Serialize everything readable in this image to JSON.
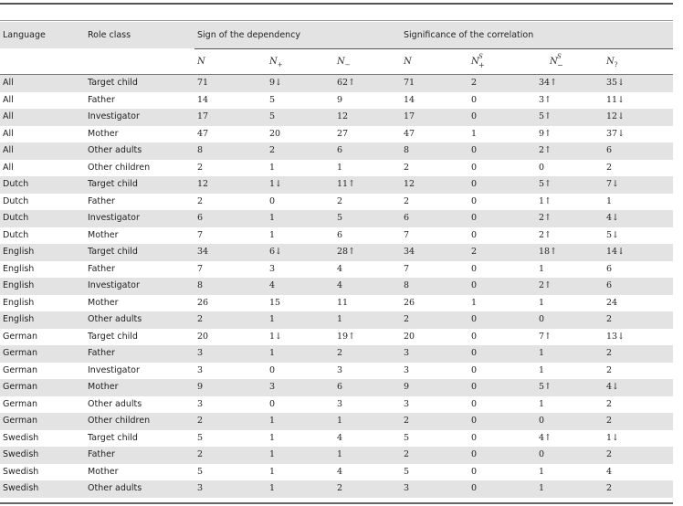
{
  "table": {
    "group_headers": {
      "language": "Language",
      "role_class": "Role class",
      "sign": "Sign of the dependency",
      "significance": "Significance of the correlation"
    },
    "sub_headers": {
      "sign_n": "N",
      "sign_n_plus": "N",
      "sign_n_plus_sub": "+",
      "sign_n_minus": "N",
      "sign_n_minus_sub": "−",
      "sig_n": "N",
      "sig_ns_plus": "N",
      "sig_ns_plus_sup": "S",
      "sig_ns_plus_sub": "+",
      "sig_ns_minus": "N",
      "sig_ns_minus_sup": "S",
      "sig_ns_minus_sub": "−",
      "sig_n_q": "N",
      "sig_n_q_sub": "?"
    },
    "rows": [
      [
        "All",
        "Target child",
        "71",
        "9↓",
        "62↑",
        "71",
        "2",
        "34↑",
        "35↓"
      ],
      [
        "All",
        "Father",
        "14",
        "5",
        "9",
        "14",
        "0",
        "3↑",
        "11↓"
      ],
      [
        "All",
        "Investigator",
        "17",
        "5",
        "12",
        "17",
        "0",
        "5↑",
        "12↓"
      ],
      [
        "All",
        "Mother",
        "47",
        "20",
        "27",
        "47",
        "1",
        "9↑",
        "37↓"
      ],
      [
        "All",
        "Other adults",
        "8",
        "2",
        "6",
        "8",
        "0",
        "2↑",
        "6"
      ],
      [
        "All",
        "Other children",
        "2",
        "1",
        "1",
        "2",
        "0",
        "0",
        "2"
      ],
      [
        "Dutch",
        "Target child",
        "12",
        "1↓",
        "11↑",
        "12",
        "0",
        "5↑",
        "7↓"
      ],
      [
        "Dutch",
        "Father",
        "2",
        "0",
        "2",
        "2",
        "0",
        "1↑",
        "1"
      ],
      [
        "Dutch",
        "Investigator",
        "6",
        "1",
        "5",
        "6",
        "0",
        "2↑",
        "4↓"
      ],
      [
        "Dutch",
        "Mother",
        "7",
        "1",
        "6",
        "7",
        "0",
        "2↑",
        "5↓"
      ],
      [
        "English",
        "Target child",
        "34",
        "6↓",
        "28↑",
        "34",
        "2",
        "18↑",
        "14↓"
      ],
      [
        "English",
        "Father",
        "7",
        "3",
        "4",
        "7",
        "0",
        "1",
        "6"
      ],
      [
        "English",
        "Investigator",
        "8",
        "4",
        "4",
        "8",
        "0",
        "2↑",
        "6"
      ],
      [
        "English",
        "Mother",
        "26",
        "15",
        "11",
        "26",
        "1",
        "1",
        "24"
      ],
      [
        "English",
        "Other adults",
        "2",
        "1",
        "1",
        "2",
        "0",
        "0",
        "2"
      ],
      [
        "German",
        "Target child",
        "20",
        "1↓",
        "19↑",
        "20",
        "0",
        "7↑",
        "13↓"
      ],
      [
        "German",
        "Father",
        "3",
        "1",
        "2",
        "3",
        "0",
        "1",
        "2"
      ],
      [
        "German",
        "Investigator",
        "3",
        "0",
        "3",
        "3",
        "0",
        "1",
        "2"
      ],
      [
        "German",
        "Mother",
        "9",
        "3",
        "6",
        "9",
        "0",
        "5↑",
        "4↓"
      ],
      [
        "German",
        "Other adults",
        "3",
        "0",
        "3",
        "3",
        "0",
        "1",
        "2"
      ],
      [
        "German",
        "Other children",
        "2",
        "1",
        "1",
        "2",
        "0",
        "0",
        "2"
      ],
      [
        "Swedish",
        "Target child",
        "5",
        "1",
        "4",
        "5",
        "0",
        "4↑",
        "1↓"
      ],
      [
        "Swedish",
        "Father",
        "2",
        "1",
        "1",
        "2",
        "0",
        "0",
        "2"
      ],
      [
        "Swedish",
        "Mother",
        "5",
        "1",
        "4",
        "5",
        "0",
        "1",
        "4"
      ],
      [
        "Swedish",
        "Other adults",
        "3",
        "1",
        "2",
        "3",
        "0",
        "1",
        "2"
      ]
    ]
  },
  "colors": {
    "row_shade": "#e3e3e3",
    "rule": "#555555"
  }
}
